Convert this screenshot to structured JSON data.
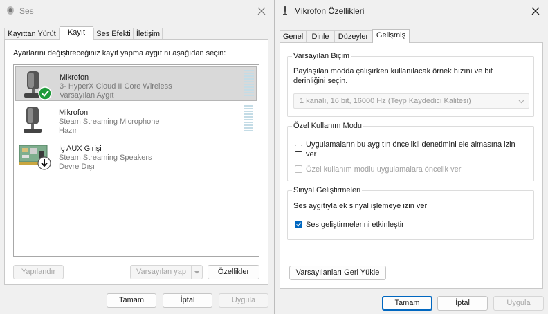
{
  "sound_window": {
    "title": "Ses",
    "tabs": [
      "Kayıttan Yürüt",
      "Kayıt",
      "Ses Efekti",
      "İletişim"
    ],
    "instruction": "Ayarlarını değiştireceğiniz kayıt yapma aygıtını aşağıdan seçin:",
    "devices": [
      {
        "name": "Mikrofon",
        "description": "3- HyperX Cloud II Core Wireless",
        "status": "Varsayılan Aygıt",
        "icon": "microphone-icon",
        "badge": "default-check-icon"
      },
      {
        "name": "Mikrofon",
        "description": "Steam Streaming Microphone",
        "status": "Hazır",
        "icon": "microphone-icon",
        "badge": ""
      },
      {
        "name": "İç AUX Girişi",
        "description": "Steam Streaming Speakers",
        "status": "Devre Dışı",
        "icon": "circuit-board-icon",
        "badge": "disabled-arrow-icon"
      }
    ],
    "configure_label": "Yapılandır",
    "set_default_label": "Varsayılan yap",
    "properties_label": "Özellikler",
    "ok_label": "Tamam",
    "cancel_label": "İptal",
    "apply_label": "Uygula"
  },
  "mic_properties": {
    "title": "Mikrofon Özellikleri",
    "tabs": [
      "Genel",
      "Dinle",
      "Düzeyler",
      "Gelişmiş"
    ],
    "default_format": {
      "group_title": "Varsayılan Biçim",
      "description": "Paylaşılan modda çalışırken kullanılacak örnek hızını ve bit derinliğini seçin.",
      "selected_value": "1 kanalı, 16 bit, 16000 Hz (Teyp Kaydedici Kalitesi)"
    },
    "exclusive_mode": {
      "group_title": "Özel Kullanım Modu",
      "allow_exclusive": {
        "label": "Uygulamaların bu aygıtın öncelikli denetimini ele almasına izin ver",
        "checked": false
      },
      "give_priority": {
        "label": "Özel kullanım modlu uygulamalara öncelik ver",
        "checked": false,
        "enabled": false
      }
    },
    "signal_enhancements": {
      "group_title": "Sinyal Geliştirmeleri",
      "description": "Ses aygıtıyla ek sinyal işlemeye izin ver",
      "enable_enhancements": {
        "label": "Ses geliştirmelerini etkinleştir",
        "checked": true
      }
    },
    "restore_defaults_label": "Varsayılanları Geri Yükle",
    "ok_label": "Tamam",
    "cancel_label": "İptal",
    "apply_label": "Uygula"
  },
  "colors": {
    "accent": "#0067c0",
    "default_badge": "#1f9a3a"
  }
}
